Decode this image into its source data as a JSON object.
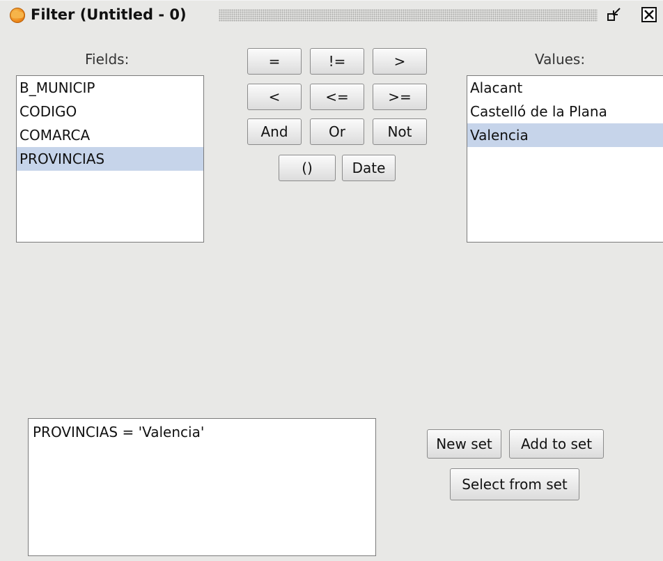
{
  "window": {
    "title": "Filter (Untitled - 0)",
    "icon": "gvsig-app-icon"
  },
  "fields": {
    "label": "Fields:",
    "items": [
      {
        "label": "B_MUNICIP",
        "selected": false
      },
      {
        "label": "CODIGO",
        "selected": false
      },
      {
        "label": "COMARCA",
        "selected": false
      },
      {
        "label": "PROVINCIAS",
        "selected": true
      }
    ]
  },
  "values": {
    "label": "Values:",
    "items": [
      {
        "label": "Alacant",
        "selected": false
      },
      {
        "label": "Castelló de la Plana",
        "selected": false
      },
      {
        "label": "Valencia",
        "selected": true
      }
    ]
  },
  "operators": {
    "eq": "=",
    "neq": "!=",
    "gt": ">",
    "lt": "<",
    "lte": "<=",
    "gte": ">=",
    "and": "And",
    "or": "Or",
    "not": "Not",
    "parens": "()",
    "date": "Date"
  },
  "expression": "PROVINCIAS = 'Valencia'",
  "actions": {
    "new_set": "New set",
    "add_to_set": "Add to set",
    "select_from_set": "Select from set"
  },
  "colors": {
    "selection": "#c6d4ea",
    "background": "#e8e8e6"
  }
}
